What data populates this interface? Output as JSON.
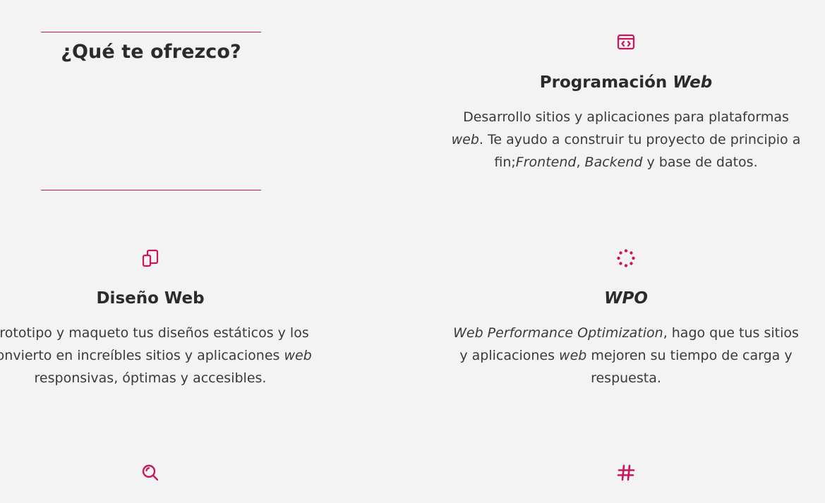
{
  "section": {
    "title": "¿Qué te ofrezco?"
  },
  "services": {
    "web": {
      "icon": "code-window-icon",
      "title_plain": "Programación ",
      "title_em": "Web",
      "desc_1": "Desarrollo sitios y aplicaciones para plataformas ",
      "desc_em_1": "web",
      "desc_2": ". Te ayudo a construir tu proyecto de principio a fin;",
      "desc_em_2": "Frontend",
      "desc_3": ", ",
      "desc_em_3": "Backend",
      "desc_4": " y base de datos."
    },
    "diseno": {
      "icon": "responsive-devices-icon",
      "title": "Diseño Web",
      "desc_1": "Prototipo y maqueto tus diseños estáticos y los convierto en increíbles sitios y aplicaciones ",
      "desc_em_1": "web",
      "desc_2": " responsivas, óptimas y accesibles."
    },
    "wpo": {
      "icon": "loading-dots-icon",
      "title_em": "WPO",
      "desc_em_1": "Web Performance Optimization",
      "desc_1": ", hago que tus sitios y aplicaciones ",
      "desc_em_2": "web",
      "desc_2": " mejoren su tiempo de carga y respuesta."
    },
    "seo": {
      "icon": "search-magnifier-icon"
    },
    "hashtag": {
      "icon": "hashtag-icon"
    }
  },
  "colors": {
    "accent": "#c8175d",
    "background": "#f3f3f3",
    "text": "#2b2b2b"
  }
}
